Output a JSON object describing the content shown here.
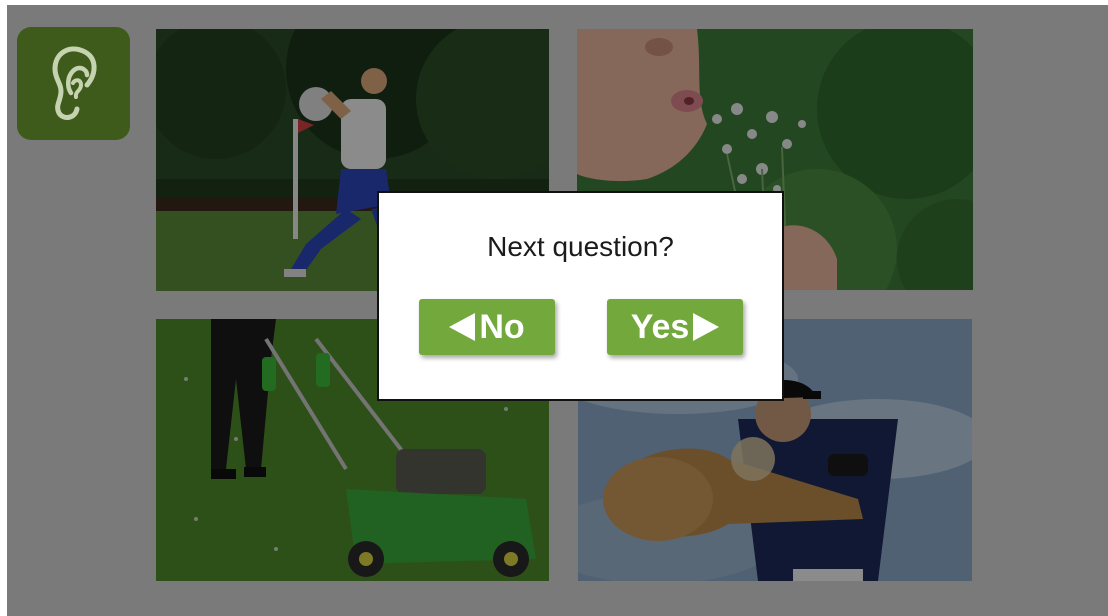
{
  "stage": {
    "background": "#7a7a7a"
  },
  "ear_button": {
    "icon": "ear-icon",
    "color": "#3f5b1c"
  },
  "photos": [
    {
      "subject": "child-kicking-soccer-ball"
    },
    {
      "subject": "child-blowing-flowers"
    },
    {
      "subject": "person-mowing-lawn"
    },
    {
      "subject": "baseball-player-swinging-bat"
    }
  ],
  "dialog": {
    "title": "Next question?",
    "no_label": "No",
    "yes_label": "Yes",
    "button_color": "#73a93c"
  }
}
